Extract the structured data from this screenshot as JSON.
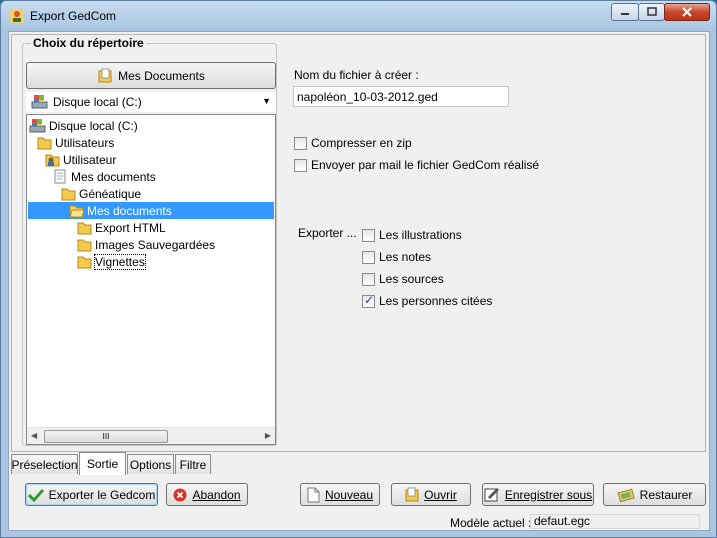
{
  "window": {
    "title": "Export GedCom"
  },
  "directory_group": {
    "title": "Choix du répertoire",
    "my_docs_button": "Mes Documents",
    "drive_combo": "Disque local (C:)",
    "tree": [
      {
        "label": "Disque local (C:)",
        "icon": "drive-icon",
        "level": 0
      },
      {
        "label": "Utilisateurs",
        "icon": "folder-icon",
        "level": 1
      },
      {
        "label": "Utilisateur",
        "icon": "user-folder-icon",
        "level": 2
      },
      {
        "label": "Mes documents",
        "icon": "documents-icon",
        "level": 3
      },
      {
        "label": "Généatique",
        "icon": "folder-icon",
        "level": 4
      },
      {
        "label": "Mes documents",
        "icon": "folder-open-icon",
        "level": 5,
        "selected": true
      },
      {
        "label": "Export HTML",
        "icon": "folder-icon",
        "level": 6
      },
      {
        "label": "Images Sauvegardées",
        "icon": "folder-icon",
        "level": 6
      },
      {
        "label": "Vignettes",
        "icon": "folder-icon",
        "level": 6,
        "focus": true
      }
    ],
    "scroll_thumb": "III"
  },
  "file": {
    "label": "Nom du fichier à créer :",
    "value": "napoléon_10-03-2012.ged"
  },
  "options": {
    "zip": {
      "label": "Compresser en zip",
      "checked": false
    },
    "mail": {
      "label": "Envoyer par mail le fichier GedCom réalisé",
      "checked": false
    }
  },
  "export": {
    "label": "Exporter ...",
    "items": [
      {
        "label": "Les illustrations",
        "checked": false
      },
      {
        "label": "Les notes",
        "checked": false
      },
      {
        "label": "Les sources",
        "checked": false
      },
      {
        "label": "Les personnes citées",
        "checked": true
      }
    ]
  },
  "tabs": [
    {
      "label": "Préselection",
      "active": false
    },
    {
      "label": "Sortie",
      "active": true
    },
    {
      "label": "Options",
      "active": false
    },
    {
      "label": "Filtre",
      "active": false
    }
  ],
  "buttons": {
    "export": "Exporter le Gedcom",
    "abort": "Abandon",
    "new": "Nouveau",
    "open": "Ouvrir",
    "save_as": "Enregistrer sous",
    "restore": "Restaurer"
  },
  "status": {
    "model_label": "Modèle actuel :",
    "model_value": "defaut.egc"
  },
  "colors": {
    "selection": "#3399ff",
    "title_bar": "#a9c5e2",
    "close_button": "#c7462b"
  }
}
